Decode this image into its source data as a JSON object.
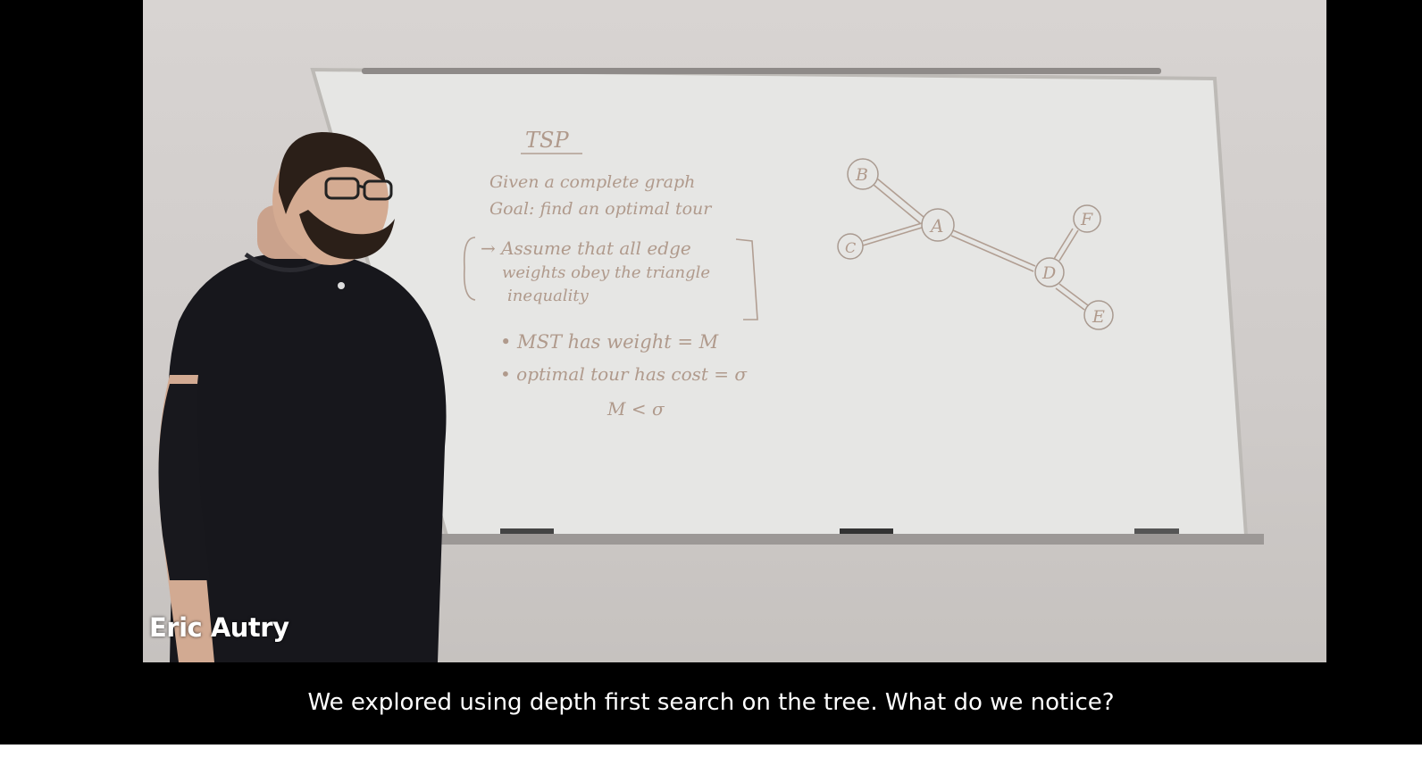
{
  "speaker": {
    "name": "Eric Autry"
  },
  "caption": {
    "text": "We explored using depth first search on the tree. What do we notice?"
  },
  "whiteboard": {
    "title": "TSP",
    "lines": [
      "Given a complete graph",
      "Goal: find an optimal tour",
      "→ Assume that all edge",
      "weights obey the triangle",
      "inequality",
      "• MST has weight = M",
      "• optimal tour has cost = σ",
      "M < σ"
    ],
    "graph_nodes": [
      "B",
      "A",
      "C",
      "F",
      "D",
      "E"
    ]
  }
}
